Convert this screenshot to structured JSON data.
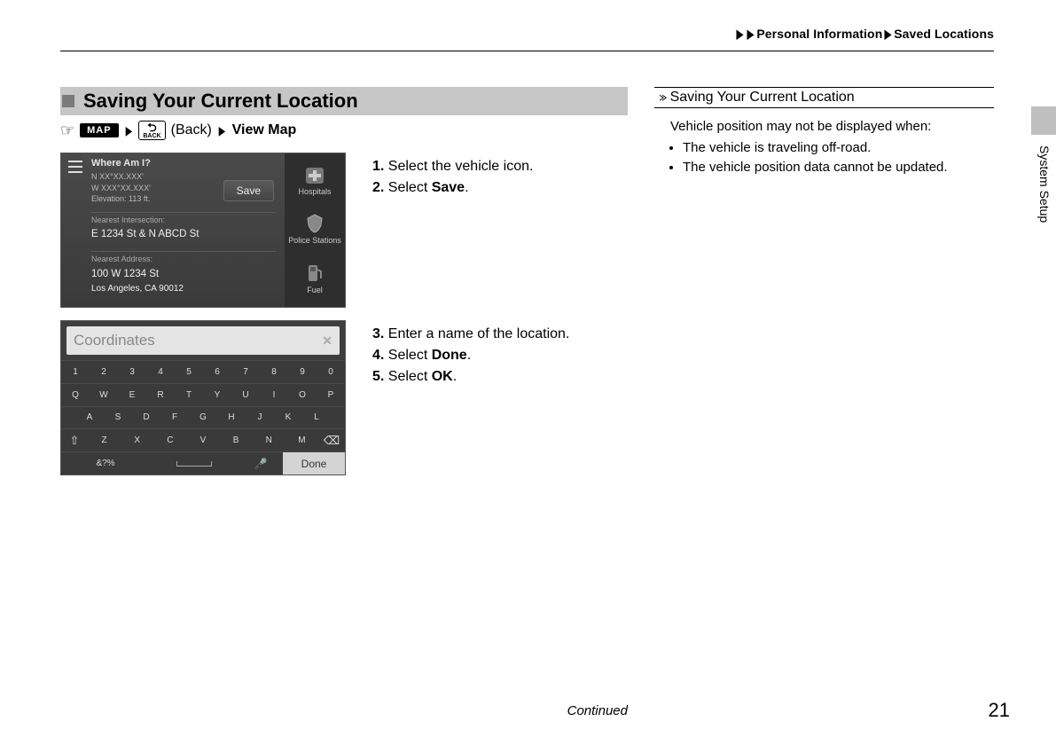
{
  "breadcrumb": {
    "item1": "Personal Information",
    "item2": "Saved Locations"
  },
  "side_tab": "System Setup",
  "section_title": "Saving Your Current Location",
  "nav": {
    "map_badge": "MAP",
    "back_label": "BACK",
    "back_paren": "(Back)",
    "view_map": "View Map"
  },
  "screen1": {
    "title": "Where Am I?",
    "lat": "N XX°XX.XXX'",
    "lon": "W XXX°XX.XXX'",
    "elev": "Elevation: 113 ft.",
    "save": "Save",
    "intersection_label": "Nearest Intersection:",
    "intersection_value": "E 1234 St & N ABCD St",
    "address_label": "Nearest Address:",
    "address_line1": "100 W 1234 St",
    "address_line2": "Los Angeles, CA 90012",
    "side": {
      "hospitals": "Hospitals",
      "police": "Police Stations",
      "fuel": "Fuel"
    }
  },
  "steps1": {
    "s1a": "1.",
    "s1b": " Select the vehicle icon.",
    "s2a": "2.",
    "s2b": " Select ",
    "s2c": "Save",
    "s2d": "."
  },
  "screen2": {
    "placeholder": "Coordinates",
    "row1": [
      "1",
      "2",
      "3",
      "4",
      "5",
      "6",
      "7",
      "8",
      "9",
      "0"
    ],
    "row2": [
      "Q",
      "W",
      "E",
      "R",
      "T",
      "Y",
      "U",
      "I",
      "O",
      "P"
    ],
    "row3": [
      "A",
      "S",
      "D",
      "F",
      "G",
      "H",
      "J",
      "K",
      "L"
    ],
    "row4": [
      "Z",
      "X",
      "C",
      "V",
      "B",
      "N",
      "M"
    ],
    "sym": "&?%",
    "done": "Done"
  },
  "steps2": {
    "s3a": "3.",
    "s3b": " Enter a name of the location.",
    "s4a": "4.",
    "s4b": " Select ",
    "s4c": "Done",
    "s4d": ".",
    "s5a": "5.",
    "s5b": " Select ",
    "s5c": "OK",
    "s5d": "."
  },
  "note": {
    "title": "Saving Your Current Location",
    "intro": "Vehicle position may not be displayed when:",
    "b1": "The vehicle is traveling off-road.",
    "b2": "The vehicle position data cannot be updated."
  },
  "footer": {
    "continued": "Continued",
    "page": "21"
  }
}
